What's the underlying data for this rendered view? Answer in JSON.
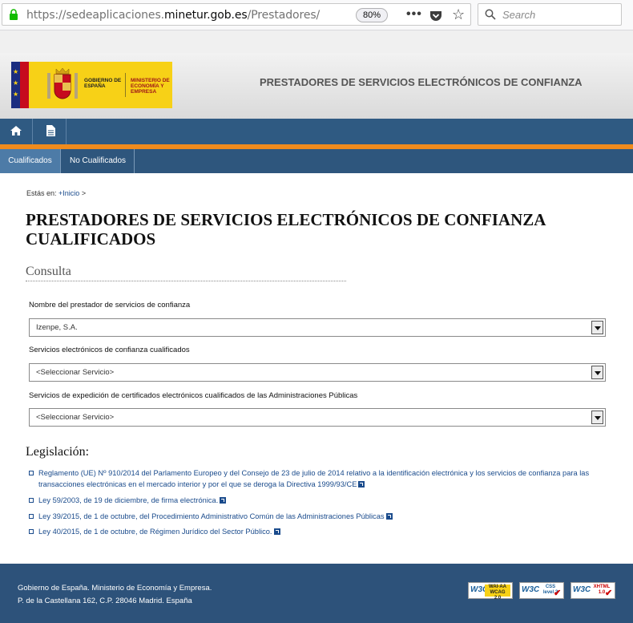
{
  "browser": {
    "url_prefix": "https://sedeaplicaciones.",
    "url_domain": "minetur.gob.es",
    "url_path": "/Prestadores/",
    "zoom": "80%",
    "search_placeholder": "Search"
  },
  "header": {
    "gov_label": "GOBIERNO DE ESPAÑA",
    "ministry_label": "MINISTERIO DE ECONOMÍA Y EMPRESA",
    "title": "PRESTADORES DE SERVICIOS ELECTRÓNICOS DE CONFIANZA"
  },
  "tabs": [
    {
      "label": "Cualificados"
    },
    {
      "label": "No Cualificados"
    }
  ],
  "breadcrumb": {
    "prefix": "Estás en:",
    "link": "+Inicio",
    "sep": ">"
  },
  "page_title": "PRESTADORES DE SERVICIOS ELECTRÓNICOS DE CONFIANZA CUALIFICADOS",
  "consulta": {
    "title": "Consulta",
    "fields": [
      {
        "label": "Nombre del prestador de servicios de confianza",
        "value": "Izenpe, S.A."
      },
      {
        "label": "Servicios electrónicos de confianza cualificados",
        "value": "<Seleccionar Servicio>"
      },
      {
        "label": "Servicios de expedición de certificados electrónicos cualificados de las Administraciones Públicas",
        "value": "<Seleccionar Servicio>"
      }
    ]
  },
  "legislacion": {
    "title": "Legislación:",
    "items": [
      "Reglamento (UE) Nº 910/2014 del Parlamento Europeo y del Consejo de 23 de julio de 2014 relativo a la identificación electrónica y los servicios de confianza para las transacciones electrónicas en el mercado interior y por el que se deroga la Directiva 1999/93/CE",
      "Ley 59/2003, de 19 de diciembre, de firma electrónica.",
      "Ley 39/2015, de 1 de octubre, del Procedimiento Administrativo Común de las Administraciones Públicas",
      "Ley 40/2015, de 1 de octubre, de Régimen Jurídico del Sector Público."
    ]
  },
  "footer": {
    "line1": "Gobierno de España. Ministerio de Economía y Empresa.",
    "line2": "P. de la Castellana 162, C.P. 28046 Madrid. España",
    "badges": [
      {
        "logo": "W3C",
        "text": "WAI-AA WCAG 2.0"
      },
      {
        "logo": "W3C",
        "text": "CSS level 2"
      },
      {
        "logo": "W3C",
        "text": "XHTML 1.0"
      }
    ]
  }
}
